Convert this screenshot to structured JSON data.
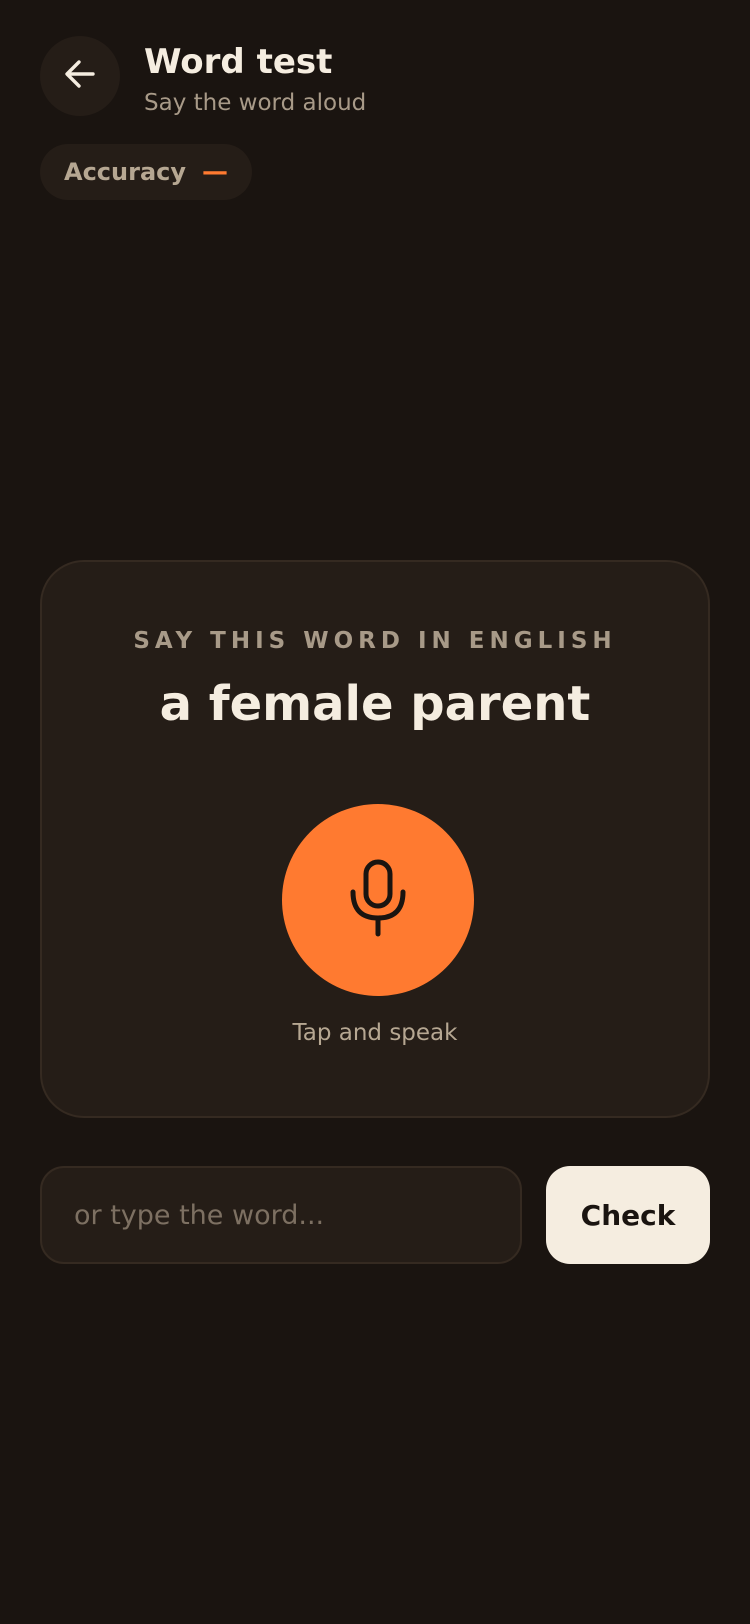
{
  "header": {
    "title": "Word test",
    "subtitle": "Say the word aloud",
    "back_icon": "arrow-left-icon"
  },
  "accuracy": {
    "label": "Accuracy",
    "value": "—"
  },
  "card": {
    "prompt_label": "SAY THIS WORD IN ENGLISH",
    "target_word": "a female parent",
    "mic_icon": "microphone-icon",
    "mic_caption": "Tap and speak"
  },
  "answer": {
    "placeholder": "or type the word...",
    "value": "",
    "check_label": "Check"
  },
  "colors": {
    "background": "#1a1410",
    "surface": "#251d17",
    "accent": "#ff7a30",
    "text_primary": "#f5ede0",
    "text_secondary": "#a89a88"
  }
}
